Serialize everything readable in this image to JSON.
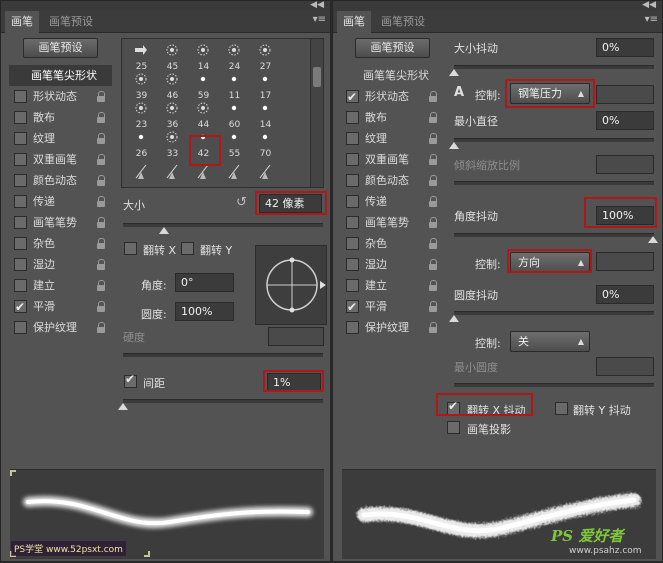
{
  "left": {
    "tabs": [
      "画笔",
      "画笔预设"
    ],
    "preset_button": "画笔预设",
    "sidebar_header": "画笔笔尖形状",
    "sidebar_items": [
      {
        "label": "形状动态",
        "checked": false
      },
      {
        "label": "散布",
        "checked": false
      },
      {
        "label": "纹理",
        "checked": false
      },
      {
        "label": "双重画笔",
        "checked": false
      },
      {
        "label": "颜色动态",
        "checked": false
      },
      {
        "label": "传递",
        "checked": false
      },
      {
        "label": "画笔笔势",
        "checked": false
      },
      {
        "label": "杂色",
        "checked": false
      },
      {
        "label": "湿边",
        "checked": false
      },
      {
        "label": "建立",
        "checked": false
      },
      {
        "label": "平滑",
        "checked": true
      },
      {
        "label": "保护纹理",
        "checked": false
      }
    ],
    "brush_sizes": [
      "25",
      "45",
      "14",
      "24",
      "27",
      "39",
      "46",
      "59",
      "11",
      "17",
      "23",
      "36",
      "44",
      "60",
      "14",
      "26",
      "33",
      "42",
      "55",
      "70"
    ],
    "size_label": "大小",
    "size_value": "42 像素",
    "flip_x": "翻转 X",
    "flip_y": "翻转 Y",
    "angle_label": "角度:",
    "angle_value": "0°",
    "roundness_label": "圆度:",
    "roundness_value": "100%",
    "hardness_label": "硬度",
    "spacing_label": "间距",
    "spacing_value": "1%",
    "watermark": "PS学堂  www.52psxt.com"
  },
  "right": {
    "tabs": [
      "画笔",
      "画笔预设"
    ],
    "preset_button": "画笔预设",
    "sidebar_header": "画笔笔尖形状",
    "sidebar_items": [
      {
        "label": "形状动态",
        "checked": true
      },
      {
        "label": "散布",
        "checked": false
      },
      {
        "label": "纹理",
        "checked": false
      },
      {
        "label": "双重画笔",
        "checked": false
      },
      {
        "label": "颜色动态",
        "checked": false
      },
      {
        "label": "传递",
        "checked": false
      },
      {
        "label": "画笔笔势",
        "checked": false
      },
      {
        "label": "杂色",
        "checked": false
      },
      {
        "label": "湿边",
        "checked": false
      },
      {
        "label": "建立",
        "checked": false
      },
      {
        "label": "平滑",
        "checked": true
      },
      {
        "label": "保护纹理",
        "checked": false
      }
    ],
    "size_jitter_label": "大小抖动",
    "size_jitter_value": "0%",
    "control_label": "控制:",
    "control1_value": "钢笔压力",
    "min_diameter_label": "最小直径",
    "min_diameter_value": "0%",
    "tilt_scale_label": "倾斜缩放比例",
    "angle_jitter_label": "角度抖动",
    "angle_jitter_value": "100%",
    "control2_value": "方向",
    "roundness_jitter_label": "圆度抖动",
    "roundness_jitter_value": "0%",
    "control3_value": "关",
    "min_roundness_label": "最小圆度",
    "flip_x_jitter": "翻转 X 抖动",
    "flip_y_jitter": "翻转 Y 抖动",
    "brush_projection": "画笔投影",
    "watermark": "PS 爱好者",
    "watermark_url": "www.psahz.com"
  },
  "colors": {
    "panel": "#535353",
    "highlight_border": "#b01818"
  }
}
